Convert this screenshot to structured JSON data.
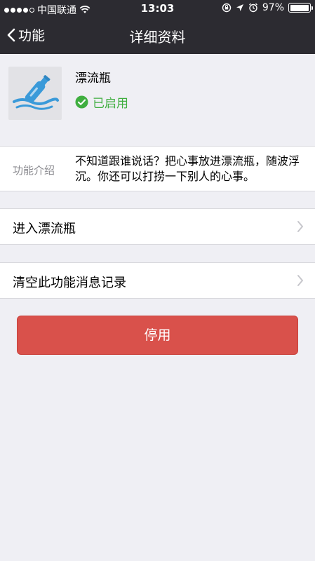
{
  "status": {
    "carrier": "中国联通",
    "time": "13:03",
    "battery": "97%",
    "battery_level": 97
  },
  "nav": {
    "back_label": "功能",
    "title": "详细资料"
  },
  "app": {
    "name": "漂流瓶",
    "status": "已启用",
    "icon": "bottle-icon",
    "status_color": "#3fae3f"
  },
  "intro": {
    "label": "功能介绍",
    "text": "不知道跟谁说话？把心事放进漂流瓶，随波浮沉。你还可以打捞一下别人的心事。"
  },
  "rows": [
    {
      "label": "进入漂流瓶"
    },
    {
      "label": "清空此功能消息记录"
    }
  ],
  "disable_button": {
    "label": "停用",
    "color": "#d9514b"
  }
}
